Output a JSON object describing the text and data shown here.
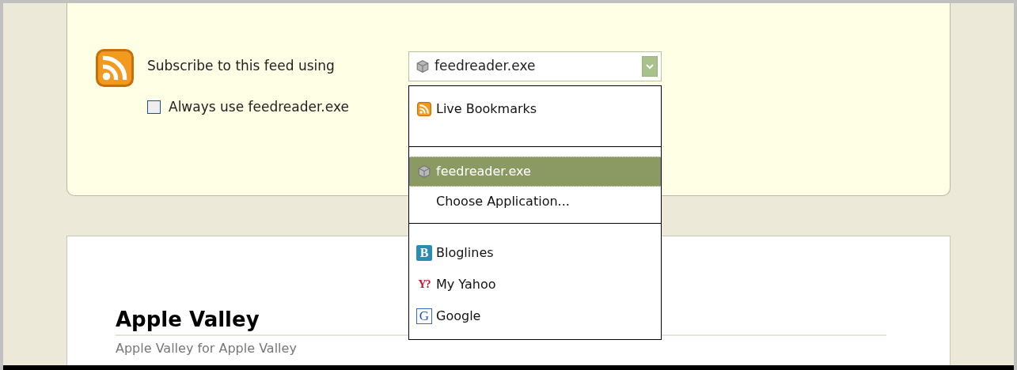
{
  "subscribe": {
    "label": "Subscribe to this feed using",
    "value": "feedreader.exe",
    "always_use": {
      "label": "Always use feedreader.exe",
      "checked": false
    }
  },
  "menu": {
    "groups": [
      [
        {
          "label": "Live Bookmarks",
          "selected": false
        }
      ],
      [
        {
          "label": "feedreader.exe",
          "selected": true
        },
        {
          "label": "Choose Application...",
          "selected": false
        }
      ],
      [
        {
          "label": "Bloglines",
          "icon_text": "B",
          "selected": false
        },
        {
          "label": "My Yahoo",
          "icon_text": "Y?",
          "selected": false
        },
        {
          "label": "Google",
          "icon_text": "G",
          "selected": false
        }
      ]
    ]
  },
  "feed": {
    "title": "Apple Valley",
    "subtitle": "Apple Valley for Apple Valley"
  }
}
